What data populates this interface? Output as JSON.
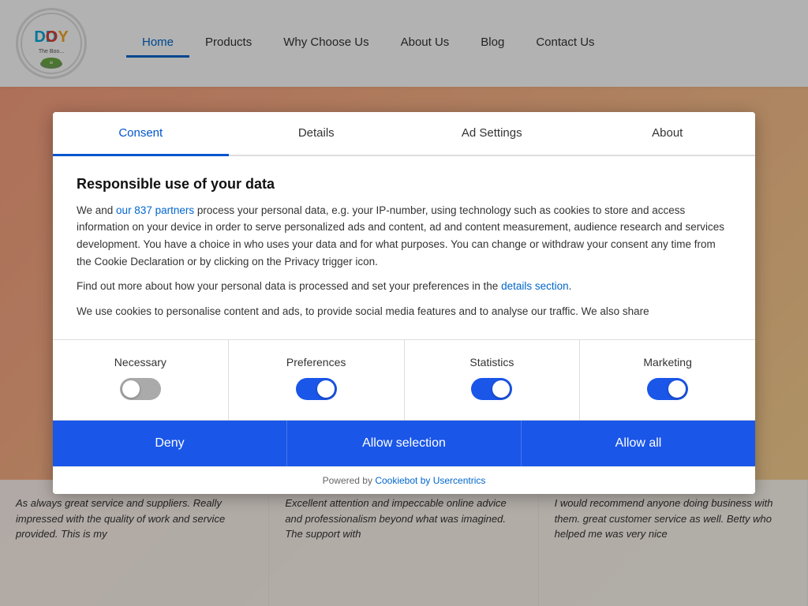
{
  "navbar": {
    "logo_text": "DOY",
    "logo_subtitle": "The Boo...",
    "links": [
      {
        "label": "Home",
        "active": true
      },
      {
        "label": "Products",
        "active": false
      },
      {
        "label": "Why Choose Us",
        "active": false
      },
      {
        "label": "About Us",
        "active": false
      },
      {
        "label": "Blog",
        "active": false
      },
      {
        "label": "Contact Us",
        "active": false
      }
    ]
  },
  "consent": {
    "tabs": [
      {
        "label": "Consent",
        "active": true
      },
      {
        "label": "Details",
        "active": false
      },
      {
        "label": "Ad Settings",
        "active": false
      },
      {
        "label": "About",
        "active": false
      }
    ],
    "title": "Responsible use of your data",
    "intro_text": "We and",
    "partners_link": "our 837 partners",
    "body_text": " process your personal data, e.g. your IP-number, using technology such as cookies to store and access information on your device in order to serve personalized ads and content, ad and content measurement, audience research and services development. You have a choice in who uses your data and for what purposes. You can change or withdraw your consent any time from the Cookie Declaration or by clicking on the Privacy trigger icon.",
    "find_more_text": "Find out more about how your personal data is processed and set your preferences in the",
    "details_link": "details section",
    "faded_text": "We use cookies to personalise content and ads, to provide social media features and to analyse our traffic. We also share",
    "toggles": [
      {
        "label": "Necessary",
        "state": "disabled",
        "on": false
      },
      {
        "label": "Preferences",
        "state": "on",
        "on": true
      },
      {
        "label": "Statistics",
        "state": "on",
        "on": true
      },
      {
        "label": "Marketing",
        "state": "on",
        "on": true
      }
    ],
    "buttons": [
      {
        "label": "Deny",
        "key": "deny"
      },
      {
        "label": "Allow selection",
        "key": "selection"
      },
      {
        "label": "Allow all",
        "key": "allow"
      }
    ],
    "powered_by": "Powered by",
    "powered_by_link": "Cookiebot by Usercentrics"
  },
  "testimonials": [
    "As always great service and suppliers. Really impressed with the quality of work and service provided. This is my",
    "Excellent attention and impeccable online advice and professionalism beyond what was imagined. The support with",
    "I would recommend anyone doing business with them. great customer service as well. Betty who helped me was very nice"
  ]
}
